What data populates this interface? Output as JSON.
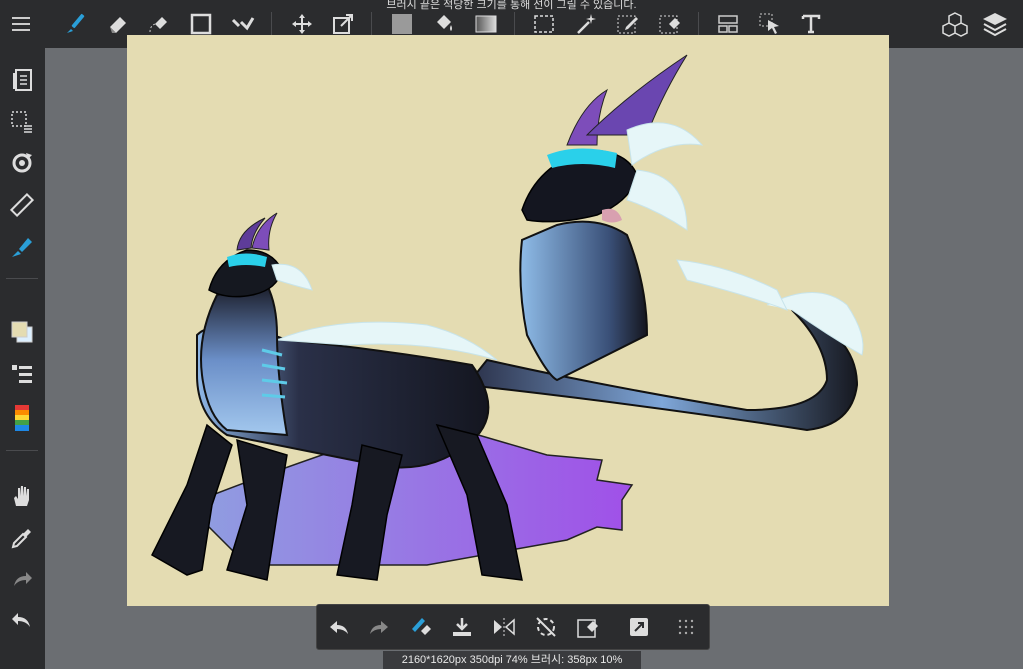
{
  "top_message": "브러시 끝은 적당한 크기를 통해 선이 그릴 수 있습니다.",
  "status_text": "2160*1620px 350dpi 74% 브러시: 358px 10%",
  "colors": {
    "accent": "#2a9fd8",
    "toolbar_bg": "#2b2c2e",
    "canvas_bg": "#e4dcb2",
    "workspace_bg": "#6b6e72"
  },
  "top_tools": [
    "menu-icon",
    "brush-icon",
    "eraser-icon",
    "lasso-eraser-icon",
    "rectangle-icon",
    "fill-lines-icon",
    "move-icon",
    "transform-icon",
    "fill-color-icon",
    "bucket-icon",
    "gradient-icon",
    "selection-icon",
    "magic-wand-icon",
    "selection-pen-icon",
    "selection-eraser-icon",
    "panel-layout-icon",
    "select-layer-icon",
    "text-icon",
    "materials-icon",
    "layers-icon"
  ],
  "side_tools": [
    "pages-icon",
    "select-layer-list-icon",
    "rotate-icon",
    "ruler-icon",
    "pen-fill-icon",
    "color-swatch-icon",
    "layer-list-icon",
    "color-palette-icon",
    "hand-icon",
    "eyedropper-icon",
    "redo-icon",
    "undo-icon"
  ],
  "bottom_tools": [
    "undo-icon",
    "redo-icon",
    "brush-eraser-toggle-icon",
    "save-icon",
    "flip-icon",
    "snap-off-icon",
    "clear-layer-icon",
    "export-icon",
    "more-grid-icon"
  ]
}
